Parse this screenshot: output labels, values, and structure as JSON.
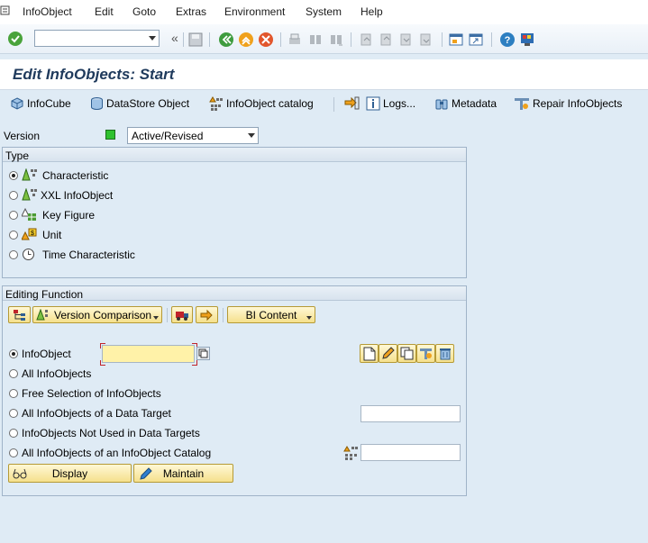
{
  "menu": {
    "items": [
      "InfoObject",
      "Edit",
      "Goto",
      "Extras",
      "Environment",
      "System",
      "Help"
    ]
  },
  "system_toolbar": {
    "command_field_value": "",
    "icons": [
      "enter-check-icon",
      "save-icon",
      "back-icon",
      "exit-icon",
      "cancel-icon",
      "print-icon",
      "find-icon",
      "find-next-icon",
      "first-page-icon",
      "prev-page-icon",
      "next-page-icon",
      "last-page-icon",
      "create-session-icon",
      "shortcut-icon",
      "help-icon",
      "customize-layout-icon"
    ]
  },
  "title": "Edit InfoObjects: Start",
  "app_toolbar": {
    "infocube": "InfoCube",
    "datastore": "DataStore Object",
    "catalog": "InfoObject catalog",
    "logs": "Logs...",
    "metadata": "Metadata",
    "repair": "Repair InfoObjects"
  },
  "version": {
    "label": "Version",
    "value": "Active/Revised",
    "status_color": "#2fc12f"
  },
  "type_group": {
    "title": "Type",
    "options": [
      {
        "label": "Characteristic",
        "selected": true
      },
      {
        "label": "XXL InfoObject",
        "selected": false
      },
      {
        "label": "Key Figure",
        "selected": false
      },
      {
        "label": "Unit",
        "selected": false
      },
      {
        "label": "Time Characteristic",
        "selected": false
      }
    ]
  },
  "editing_group": {
    "title": "Editing Function",
    "version_comparison": "Version Comparison",
    "bi_content": "BI Content",
    "infoobject_label": "InfoObject",
    "infoobject_value": "",
    "options": [
      "All InfoObjects",
      "Free Selection of InfoObjects",
      "All InfoObjects of a Data Target",
      "InfoObjects Not Used in Data Targets",
      "All InfoObjects of an InfoObject Catalog"
    ],
    "data_target_value": "",
    "catalog_value": "",
    "display_button": "Display",
    "maintain_button": "Maintain"
  }
}
